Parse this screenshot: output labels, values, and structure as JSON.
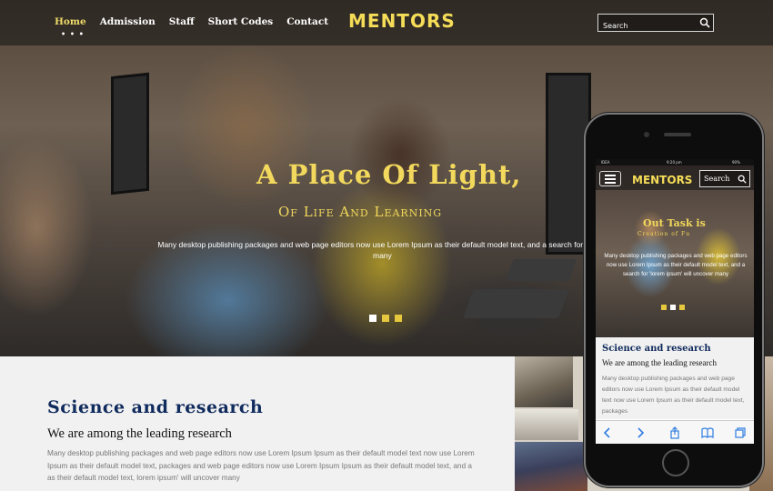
{
  "nav": {
    "items": [
      "Home",
      "Admission",
      "Staff",
      "Short Codes",
      "Contact"
    ],
    "active_index": 0,
    "brand": "MENTORS",
    "search_placeholder": "Search"
  },
  "hero": {
    "title": "A Place Of Light,",
    "subtitle": "Of Life And Learning",
    "description_line1": "Many desktop publishing packages and web page editors now use Lorem Ipsum as their default model text, and a search for 'lorem i",
    "description_line2": "many",
    "slide_count": 3,
    "current_slide": 0
  },
  "section": {
    "title": "Science and research",
    "subtitle": "We are among the leading research",
    "text": "Many desktop publishing packages and web page editors now use Lorem Ipsum Ipsum as their default model text now use Lorem Ipsum as their default model text, packages and web page editors now use Lorem Ipsum Ipsum as their default model text, and a as their default model text, lorem ipsum' will uncover many"
  },
  "phone": {
    "status": {
      "carrier": "IDEA",
      "time": "9:20 pm",
      "battery": "90%"
    },
    "brand": "MENTORS",
    "search_label": "Search",
    "hero_title": "Out Task is",
    "hero_subtitle": "Creation of Fu",
    "hero_description": "Many desktop publishing packages and web page editors now use Lorem Ipsum as their default model text, and a search for 'lorem ipsum' will uncover many",
    "section_title": "Science and research",
    "section_subtitle": "We are among the leading research",
    "section_text": "Many desktop publishing packages and web page editors now use Lorem Ipsum as their default model text now use Lorem Ipsum as their default model text, packages"
  },
  "colors": {
    "accent_yellow": "#f2d85c",
    "heading_navy": "#0f2a5c",
    "body_gray": "#777777"
  }
}
